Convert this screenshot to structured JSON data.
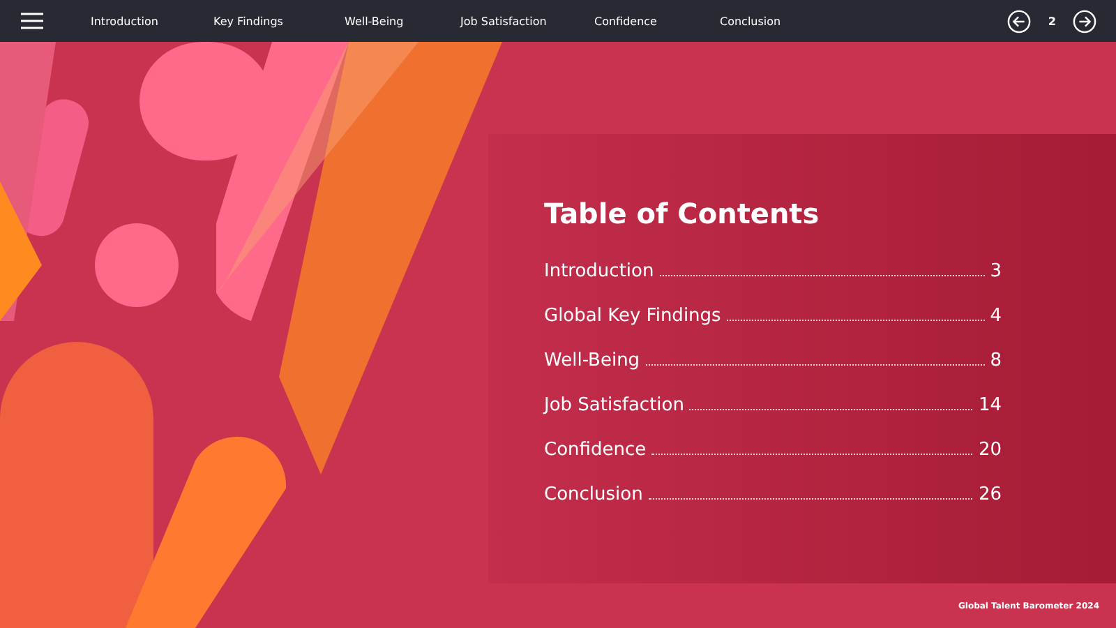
{
  "nav": {
    "items": [
      "Introduction",
      "Key Findings",
      "Well-Being",
      "Job Satisfaction",
      "Confidence",
      "Conclusion"
    ],
    "page": "2"
  },
  "toc": {
    "title": "Table of Contents",
    "entries": [
      {
        "label": "Introduction",
        "page": "3"
      },
      {
        "label": "Global Key Findings",
        "page": "4"
      },
      {
        "label": "Well-Being",
        "page": "8"
      },
      {
        "label": "Job Satisfaction",
        "page": "14"
      },
      {
        "label": "Confidence",
        "page": "20"
      },
      {
        "label": "Conclusion",
        "page": "26"
      }
    ]
  },
  "footer": "Global Talent Barometer 2024"
}
